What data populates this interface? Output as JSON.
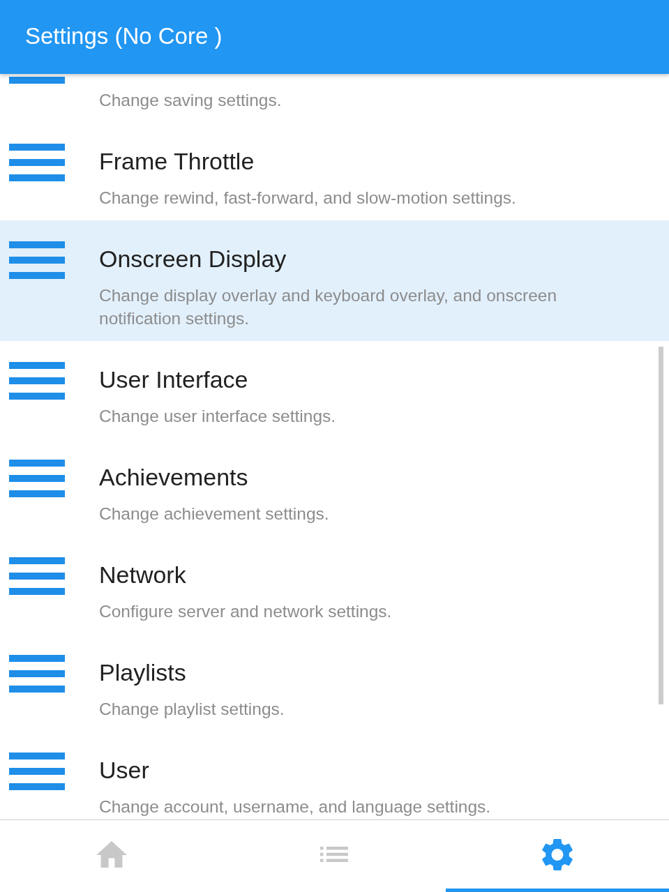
{
  "app_bar": {
    "title": "Settings (No Core )"
  },
  "items": [
    {
      "description": "Change saving settings.",
      "selected": false
    },
    {
      "title": "Frame Throttle",
      "description": "Change rewind, fast-forward, and slow-motion settings.",
      "selected": false
    },
    {
      "title": "Onscreen Display",
      "description": "Change display overlay and keyboard overlay, and onscreen notification settings.",
      "selected": true
    },
    {
      "title": "User Interface",
      "description": "Change user interface settings.",
      "selected": false
    },
    {
      "title": "Achievements",
      "description": "Change achievement settings.",
      "selected": false
    },
    {
      "title": "Network",
      "description": "Configure server and network settings.",
      "selected": false
    },
    {
      "title": "Playlists",
      "description": "Change playlist settings.",
      "selected": false
    },
    {
      "title": "User",
      "description": "Change account, username, and language settings.",
      "selected": false
    }
  ],
  "nav": {
    "tabs": [
      {
        "kind": "home",
        "selected": false
      },
      {
        "kind": "list",
        "selected": false
      },
      {
        "kind": "settings",
        "selected": true
      }
    ]
  }
}
